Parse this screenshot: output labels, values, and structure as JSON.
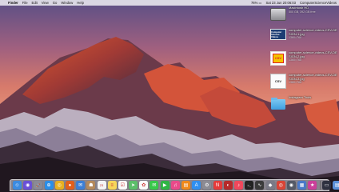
{
  "menubar": {
    "apple_glyph": "",
    "app_name": "Finder",
    "menus": [
      "File",
      "Edit",
      "View",
      "Go",
      "Window",
      "Help"
    ],
    "status": {
      "battery": "76% ▭",
      "clock": "Sat 23 Jun 20:06:03",
      "user": "ComputerScienceVideos"
    }
  },
  "desktop": {
    "items": [
      {
        "icon": "hard-disk-icon",
        "name": "Macintosh HD",
        "meta": "500 GB, 392 GB free"
      },
      {
        "icon": "image-file-icon",
        "name": "computer-science-videos-CSV-DESIGN-1.jpg",
        "meta": "1360×768"
      },
      {
        "icon": "image-file-icon",
        "name": "computer-science-videos-CSV-DESIGN-2.jpg",
        "meta": "1360×768"
      },
      {
        "icon": "csv-file-icon",
        "name": "computer-science-videos-CSV-DESIGN-3.jpg",
        "meta": "1360×768"
      },
      {
        "icon": "folder-icon",
        "name": "Instagram Tools",
        "meta": ""
      }
    ],
    "thumb_text": {
      "img1": "Computer Science Videos",
      "img2": "CSV",
      "csv": "CSV"
    }
  },
  "dock": {
    "icons": [
      {
        "name": "finder-icon",
        "color": "#3b8be0",
        "glyph": "☺"
      },
      {
        "name": "siri-icon",
        "color": "#6a4fd8",
        "glyph": "◉"
      },
      {
        "name": "launchpad-icon",
        "color": "#8a8a95",
        "glyph": "🚀"
      },
      {
        "name": "safari-icon",
        "color": "#2a8ee8",
        "glyph": "⊕"
      },
      {
        "name": "chrome-icon",
        "color": "#e8b020",
        "glyph": "◎"
      },
      {
        "name": "firefox-icon",
        "color": "#e25f1c",
        "glyph": "●"
      },
      {
        "name": "mail-icon",
        "color": "#3c7fd6",
        "glyph": "✉"
      },
      {
        "name": "contacts-icon",
        "color": "#b48a5c",
        "glyph": "☗"
      },
      {
        "name": "calendar-icon",
        "color": "#f4f4f4",
        "glyph": "23"
      },
      {
        "name": "notes-icon",
        "color": "#f6d75a",
        "glyph": "≡"
      },
      {
        "name": "reminders-icon",
        "color": "#fafafa",
        "glyph": "☑"
      },
      {
        "name": "maps-icon",
        "color": "#5cbf6a",
        "glyph": "➤"
      },
      {
        "name": "photos-icon",
        "color": "#fafafa",
        "glyph": "✿"
      },
      {
        "name": "messages-icon",
        "color": "#38c84a",
        "glyph": "✉"
      },
      {
        "name": "facetime-icon",
        "color": "#2fb545",
        "glyph": "▶"
      },
      {
        "name": "itunes-icon",
        "color": "#e94a8a",
        "glyph": "♫"
      },
      {
        "name": "ibooks-icon",
        "color": "#f08a1c",
        "glyph": "▤"
      },
      {
        "name": "app-store-icon",
        "color": "#2f8ff0",
        "glyph": "A"
      },
      {
        "name": "system-preferences-icon",
        "color": "#8c8c94",
        "glyph": "⚙"
      },
      {
        "name": "news-icon",
        "color": "#e63a3a",
        "glyph": "N"
      },
      {
        "name": "photo-booth-icon",
        "color": "#b52a2a",
        "glyph": "◐"
      },
      {
        "name": "music-icon",
        "color": "#f0485c",
        "glyph": "♪"
      },
      {
        "name": "terminal-icon",
        "color": "#222222",
        "glyph": ">_"
      },
      {
        "name": "activity-monitor-icon",
        "color": "#3a3a3a",
        "glyph": "∿"
      },
      {
        "name": "utility-icon",
        "color": "#7a7a86",
        "glyph": "◆"
      },
      {
        "name": "chrome-app-icon",
        "color": "#d94436",
        "glyph": "◎"
      },
      {
        "name": "camera-icon",
        "color": "#555a66",
        "glyph": "◉"
      },
      {
        "name": "preview-icon",
        "color": "#4a79c8",
        "glyph": "▦"
      },
      {
        "name": "itunes-store-icon",
        "color": "#cc3f9a",
        "glyph": "★"
      }
    ],
    "after_separator": [
      {
        "name": "screen-recording-icon",
        "color": "#2e3140",
        "glyph": "▭"
      },
      {
        "name": "downloads-stack-icon",
        "color": "#5a8fd8",
        "glyph": "▤"
      },
      {
        "name": "trash-icon",
        "color": "#c7ccd3",
        "glyph": "🗑"
      }
    ]
  }
}
